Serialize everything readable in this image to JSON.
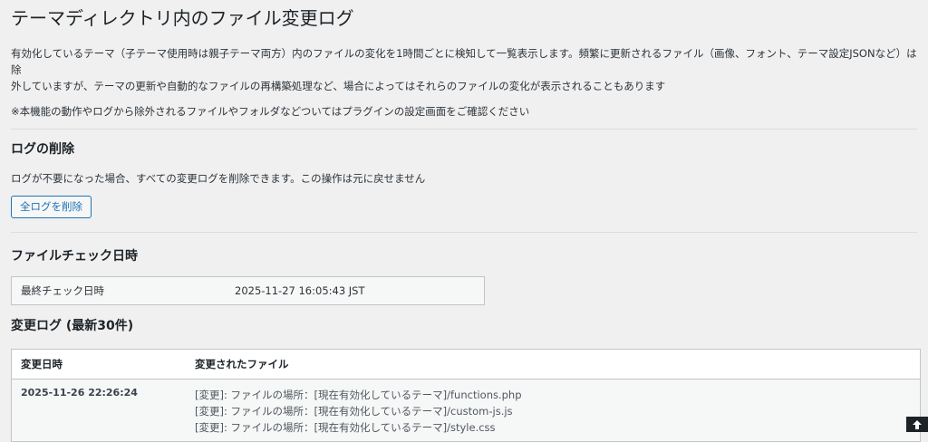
{
  "page": {
    "title": "テーマディレクトリ内のファイル変更ログ",
    "description_line1": "有効化しているテーマ（子テーマ使用時は親子テーマ両方）内のファイルの変化を1時間ごとに検知して一覧表示します。頻繁に更新されるファイル（画像、フォント、テーマ設定JSONなど）は除",
    "description_line2": "外していますが、テーマの更新や自動的なファイルの再構築処理など、場合によってはそれらのファイルの変化が表示されることもあります",
    "note": "※本機能の動作やログから除外されるファイルやフォルダなどついてはプラグインの設定画面をご確認ください"
  },
  "delete_section": {
    "heading": "ログの削除",
    "description": "ログが不要になった場合、すべての変更ログを削除できます。この操作は元に戻せません",
    "button_label": "全ログを削除"
  },
  "check_section": {
    "heading": "ファイルチェック日時",
    "label": "最終チェック日時",
    "value": "2025-11-27 16:05:43 JST"
  },
  "log_section": {
    "heading": "変更ログ (最新30件)",
    "columns": [
      "変更日時",
      "変更されたファイル"
    ],
    "rows": [
      {
        "date": "2025-11-26 22:26:24",
        "files": [
          "[変更]: ファイルの場所：[現在有効化しているテーマ]/functions.php",
          "[変更]: ファイルの場所：[現在有効化しているテーマ]/custom-js.js",
          "[変更]: ファイルの場所：[現在有効化しているテーマ]/style.css"
        ]
      }
    ]
  },
  "icons": {
    "scroll_top": "arrow-up-icon"
  }
}
